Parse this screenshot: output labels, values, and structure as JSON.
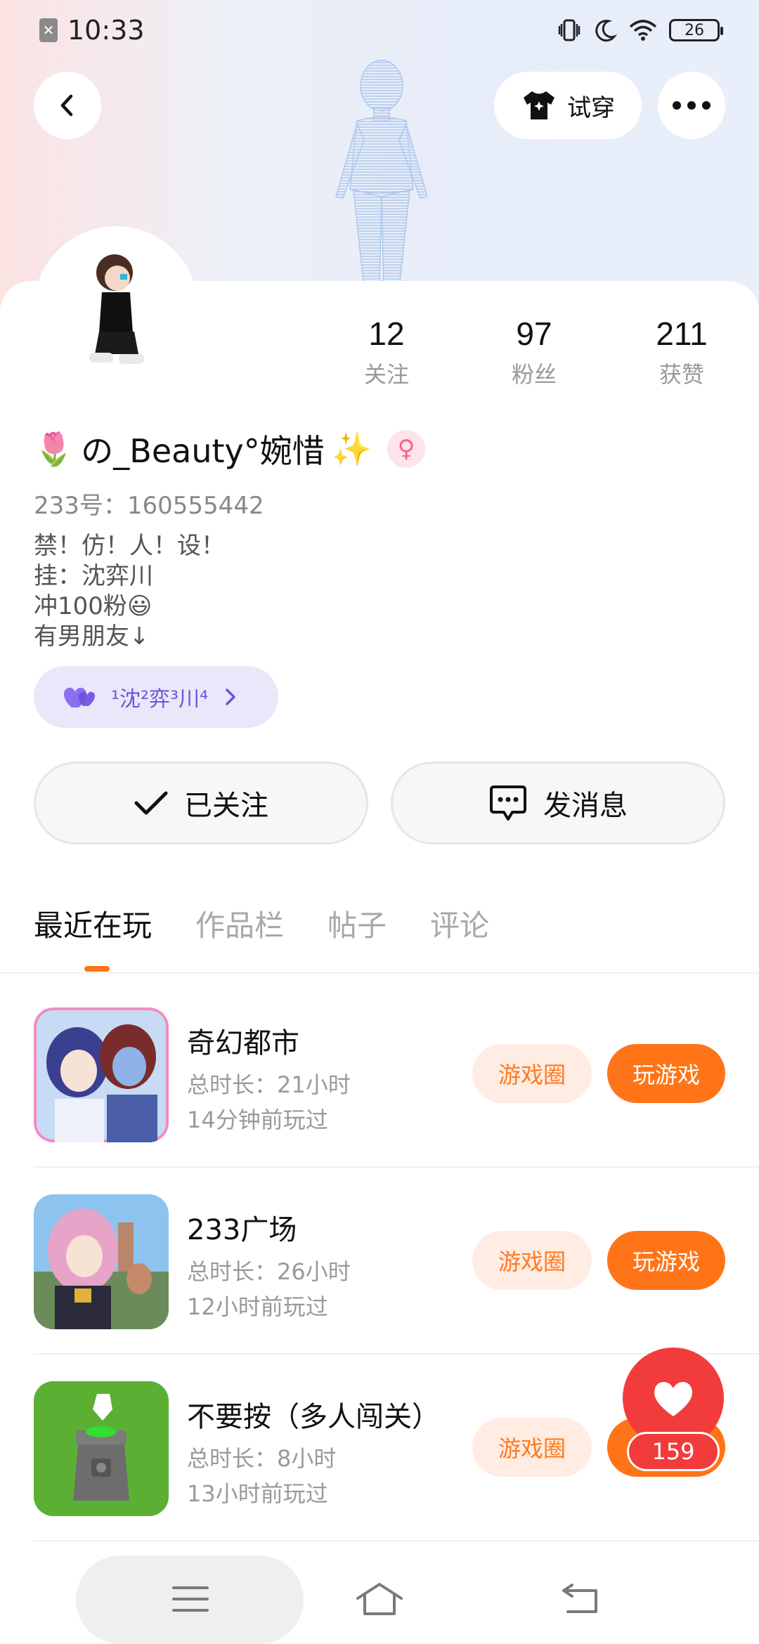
{
  "status_bar": {
    "time": "10:33",
    "battery": "26",
    "icons": [
      "sim-off-icon",
      "vibrate-icon",
      "dnd-moon-icon",
      "wifi-icon",
      "battery-icon"
    ]
  },
  "header": {
    "back_icon": "chevron-left-icon",
    "try_on_label": "试穿",
    "try_on_icon": "shirt-icon",
    "more_icon": "more-dots-icon"
  },
  "profile": {
    "name_prefix_emoji": "🌷",
    "name": "の_Beauty°婉惜",
    "name_suffix_emoji": "✨",
    "gender_symbol": "♀",
    "uid": "233号：160555442",
    "bio": [
      "禁！仿！人！设！",
      "挂：沈弈川",
      "冲100粉😃",
      "有男朋友↓"
    ],
    "cp_name": "¹沈²弈³川⁴",
    "stats": [
      {
        "value": "12",
        "label": "关注"
      },
      {
        "value": "97",
        "label": "粉丝"
      },
      {
        "value": "211",
        "label": "获赞"
      }
    ]
  },
  "actions": {
    "follow_label": "已关注",
    "message_label": "发消息"
  },
  "tabs": [
    "最近在玩",
    "作品栏",
    "帖子",
    "评论"
  ],
  "games": [
    {
      "title": "奇幻都市",
      "duration": "总时长：21小时",
      "last": "14分钟前玩过",
      "circle_label": "游戏圈",
      "play_label": "玩游戏"
    },
    {
      "title": "233广场",
      "duration": "总时长：26小时",
      "last": "12小时前玩过",
      "circle_label": "游戏圈",
      "play_label": "玩游戏"
    },
    {
      "title": "不要按（多人闯关）",
      "duration": "总时长：8小时",
      "last": "13小时前玩过",
      "circle_label": "游戏圈",
      "play_label": "玩游戏"
    }
  ],
  "like": {
    "count": "159"
  },
  "colors": {
    "accent": "#ff7418",
    "like": "#f23b3b",
    "cp": "#6b56d8"
  }
}
